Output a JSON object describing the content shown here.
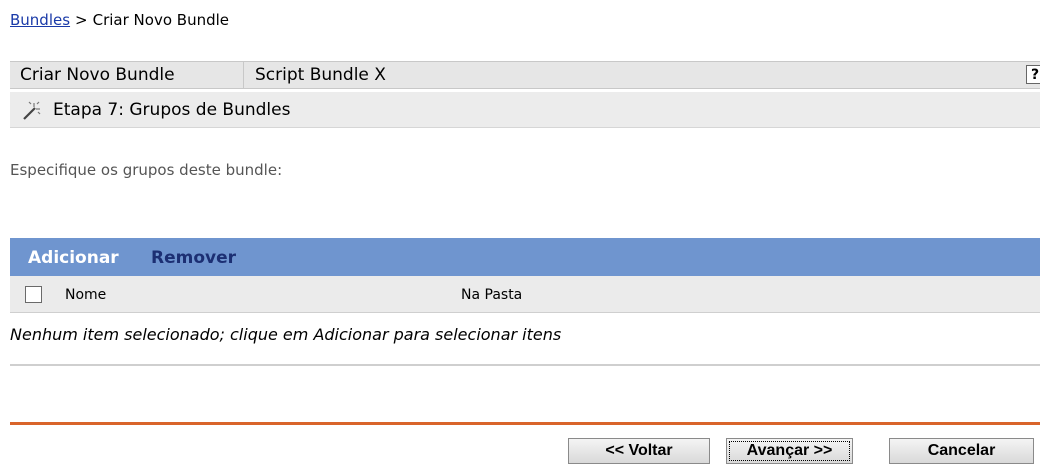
{
  "breadcrumb": {
    "link": "Bundles",
    "separator": ">",
    "current": "Criar Novo Bundle"
  },
  "title_bar": {
    "title": "Criar Novo Bundle",
    "bundle_name": "Script Bundle X",
    "help_label": "?"
  },
  "step": {
    "icon": "wand-icon",
    "title": "Etapa 7: Grupos de Bundles"
  },
  "instruction": "Especifique os grupos deste bundle:",
  "table": {
    "toolbar": {
      "add_label": "Adicionar",
      "remove_label": "Remover"
    },
    "columns": [
      "Nome",
      "Na Pasta"
    ],
    "empty_message": "Nenhum item selecionado; clique em Adicionar para selecionar itens"
  },
  "buttons": {
    "back": "<< Voltar",
    "next": "Avançar >>",
    "cancel": "Cancelar"
  },
  "colors": {
    "toolbar_bg": "#6f95cf",
    "link": "#1a3aa8",
    "divider": "#d9642a"
  }
}
